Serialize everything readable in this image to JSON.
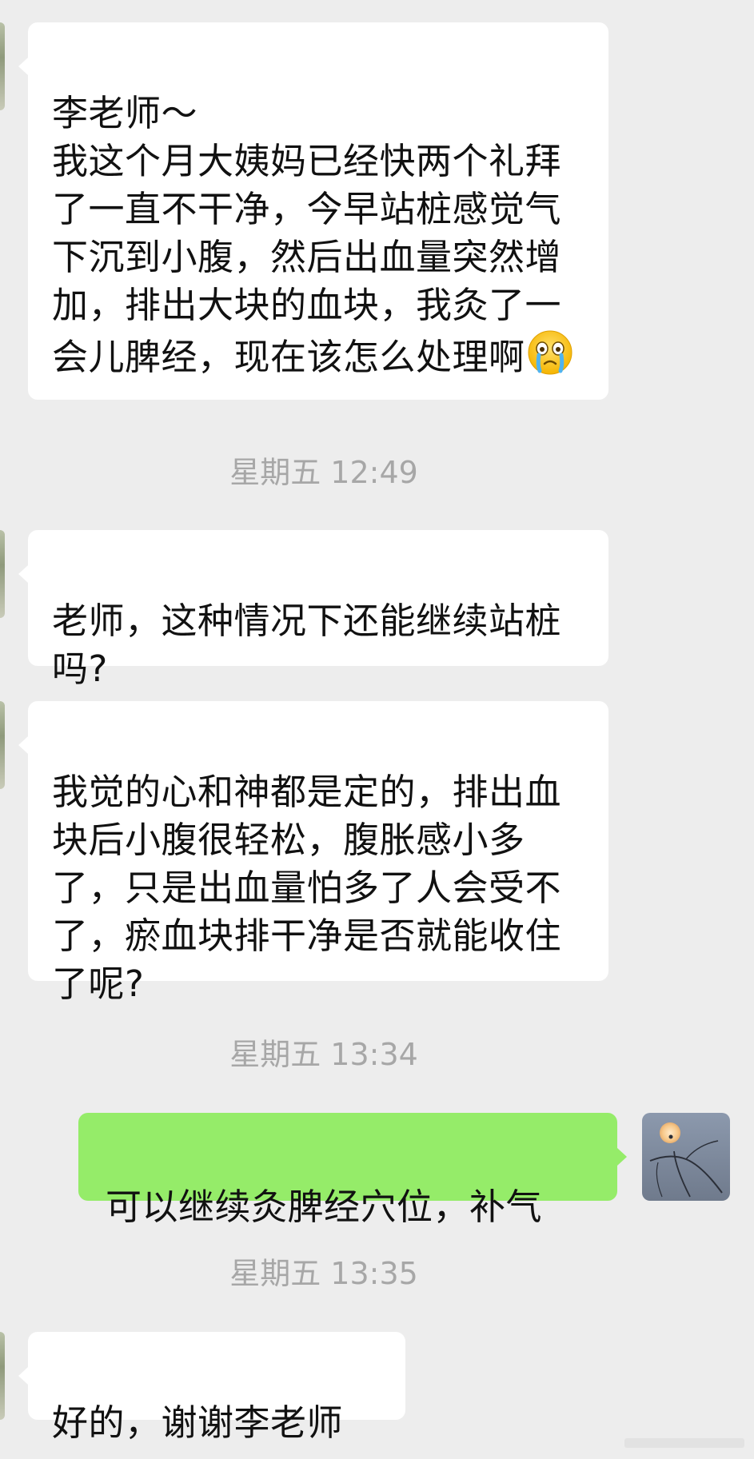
{
  "conversation": {
    "messages": [
      {
        "side": "received",
        "text": "李老师～\n我这个月大姨妈已经快两个礼拜了一直不干净，今早站桩感觉气下沉到小腹，然后出血量突然增加，排出大块的血块，我灸了一会儿脾经，现在该怎么处理啊",
        "emoji": "crying-face-emoji"
      },
      {
        "side": "timestamp",
        "text": "星期五 12:49"
      },
      {
        "side": "received",
        "text": "老师，这种情况下还能继续站桩吗?"
      },
      {
        "side": "received",
        "text": "我觉的心和神都是定的，排出血块后小腹很轻松，腹胀感小多了，只是出血量怕多了人会受不了，瘀血块排干净是否就能收住了呢?"
      },
      {
        "side": "timestamp",
        "text": "星期五 13:34"
      },
      {
        "side": "sent",
        "text": "可以继续灸脾经穴位，补气"
      },
      {
        "side": "timestamp",
        "text": "星期五 13:35"
      },
      {
        "side": "received",
        "text": "好的，谢谢李老师"
      }
    ]
  },
  "colors": {
    "background": "#ededed",
    "received_bubble": "#ffffff",
    "sent_bubble": "#95ec69",
    "timestamp_text": "#a7a7a7",
    "message_text": "#111111"
  },
  "icons": {
    "emoji": "crying-face-emoji",
    "self_avatar": "moon-branch-avatar",
    "contact_avatar": "contact-avatar"
  }
}
